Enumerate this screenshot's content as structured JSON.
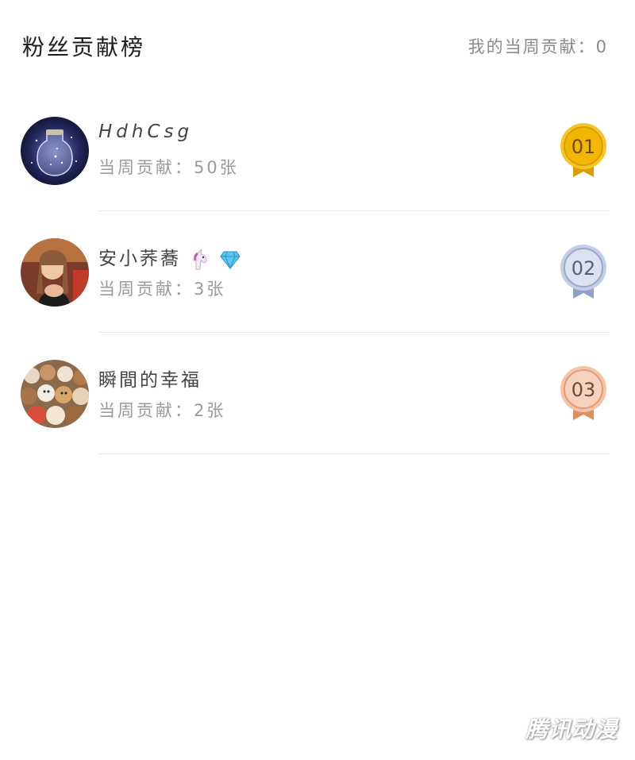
{
  "header": {
    "title": "粉丝贡献榜",
    "my_contribution": "我的当周贡献：0"
  },
  "ranking": [
    {
      "rank": "01",
      "name": "HdhCsg",
      "contribution": "当周贡献：50张",
      "medal_color": "#f2b705",
      "name_emojis": []
    },
    {
      "rank": "02",
      "name": "安小荞蕎",
      "contribution": "当周贡献：3张",
      "medal_color": "#aab7d4",
      "name_emojis": [
        "unicorn-icon",
        "diamond-icon"
      ]
    },
    {
      "rank": "03",
      "name": "瞬間的幸福",
      "contribution": "当周贡献：2张",
      "medal_color": "#f0a47c",
      "name_emojis": []
    }
  ],
  "watermark": "腾讯动漫"
}
